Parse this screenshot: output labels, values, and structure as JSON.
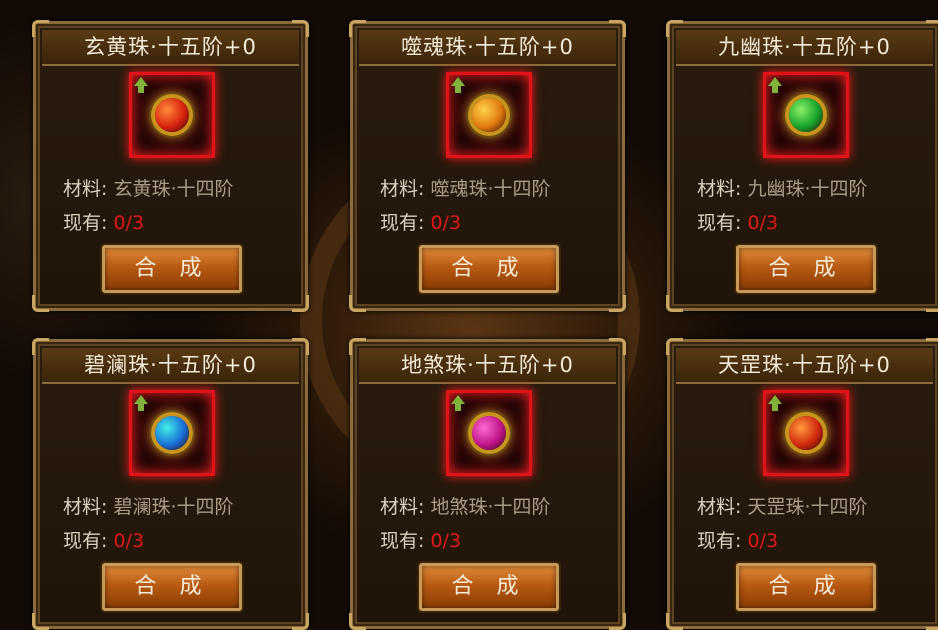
{
  "cards": [
    {
      "title": "玄黄珠·十五阶+0",
      "material_label": "材料:",
      "material": "玄黄珠·十四阶",
      "owned_label": "现有:",
      "owned": "0/3",
      "button": "合 成",
      "gem_icon": "red-orb-icon",
      "gem_color": "#d8220e",
      "gem_highlight": "#ff8a3a"
    },
    {
      "title": "噬魂珠·十五阶+0",
      "material_label": "材料:",
      "material": "噬魂珠·十四阶",
      "owned_label": "现有:",
      "owned": "0/3",
      "button": "合 成",
      "gem_icon": "orange-orb-icon",
      "gem_color": "#e07a0e",
      "gem_highlight": "#ffd24a"
    },
    {
      "title": "九幽珠·十五阶+0",
      "material_label": "材料:",
      "material": "九幽珠·十四阶",
      "owned_label": "现有:",
      "owned": "0/3",
      "button": "合 成",
      "gem_icon": "green-orb-icon",
      "gem_color": "#17a32a",
      "gem_highlight": "#8cf06a"
    },
    {
      "title": "碧澜珠·十五阶+0",
      "material_label": "材料:",
      "material": "碧澜珠·十四阶",
      "owned_label": "现有:",
      "owned": "0/3",
      "button": "合 成",
      "gem_icon": "cyan-orb-icon",
      "gem_color": "#1a6ed8",
      "gem_highlight": "#3ff0e6"
    },
    {
      "title": "地煞珠·十五阶+0",
      "material_label": "材料:",
      "material": "地煞珠·十四阶",
      "owned_label": "现有:",
      "owned": "0/3",
      "button": "合 成",
      "gem_icon": "magenta-orb-icon",
      "gem_color": "#c0148a",
      "gem_highlight": "#ff6ad0"
    },
    {
      "title": "天罡珠·十五阶+0",
      "material_label": "材料:",
      "material": "天罡珠·十四阶",
      "owned_label": "现有:",
      "owned": "0/3",
      "button": "合 成",
      "gem_icon": "red-orb-icon",
      "gem_color": "#d0280e",
      "gem_highlight": "#ff9a3a"
    }
  ],
  "upgrade_icon": "green-up-arrow-icon"
}
